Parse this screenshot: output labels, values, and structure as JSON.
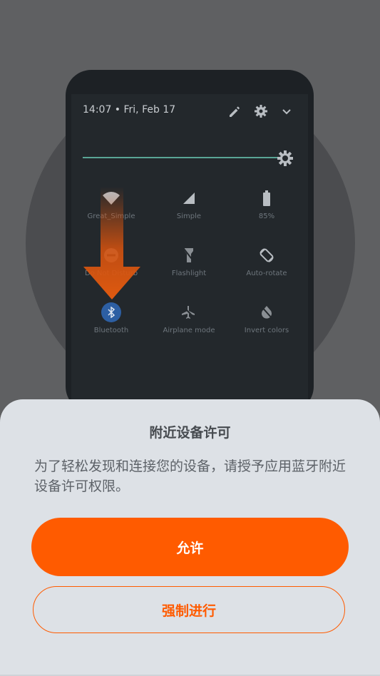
{
  "illustration": {
    "status_time": "14:07 • Fri, Feb 17",
    "tiles": [
      {
        "label": "Great_Simple",
        "icon": "wifi-icon"
      },
      {
        "label": "Simple",
        "icon": "signal-icon"
      },
      {
        "label": "85%",
        "icon": "battery-icon"
      },
      {
        "label": "Do Not Disturb",
        "icon": "do-not-disturb-icon"
      },
      {
        "label": "Flashlight",
        "icon": "flashlight-icon"
      },
      {
        "label": "Auto-rotate",
        "icon": "auto-rotate-icon"
      },
      {
        "label": "Bluetooth",
        "icon": "bluetooth-icon"
      },
      {
        "label": "Airplane mode",
        "icon": "airplane-icon"
      },
      {
        "label": "Invert colors",
        "icon": "invert-colors-icon"
      }
    ]
  },
  "dialog": {
    "title": "附近设备许可",
    "body": "为了轻松发现和连接您的设备，请授予应用蓝牙附近设备许可权限。",
    "allow_label": "允许",
    "force_label": "强制进行"
  },
  "colors": {
    "accent": "#ff5b00",
    "overlay": "#5f6062",
    "sheet": "#dde1e6"
  }
}
